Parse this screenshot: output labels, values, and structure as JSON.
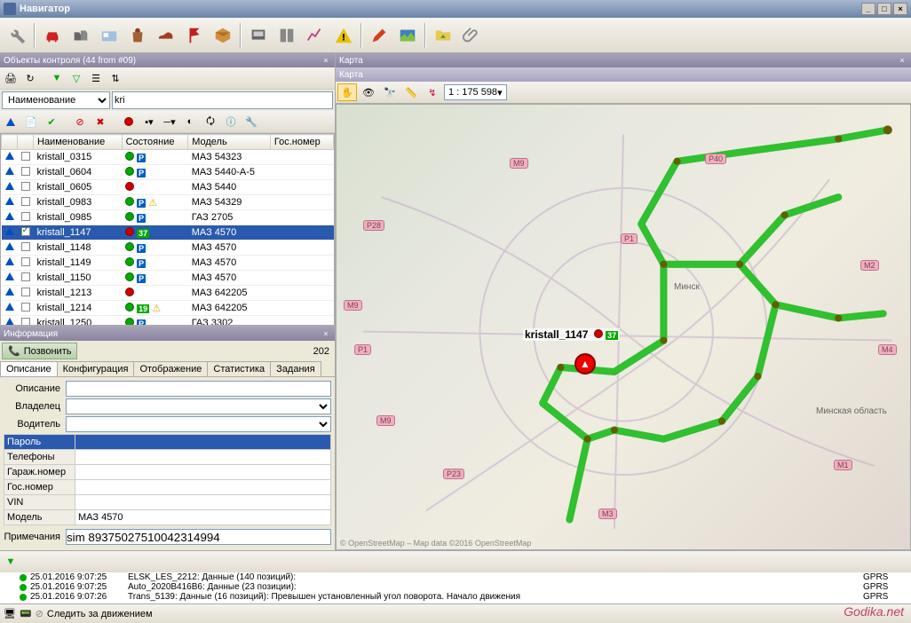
{
  "window": {
    "title": "Навигатор"
  },
  "panels": {
    "objects_title": "Объекты контроля (44 from #09)",
    "info_title": "Информация",
    "map_title": "Карта",
    "map_inner_title": "Карта"
  },
  "filter": {
    "field_label": "Наименование",
    "value": "kri"
  },
  "columns": {
    "name": "Наименование",
    "status": "Состояние",
    "model": "Модель",
    "gosnumber": "Гос.номер"
  },
  "vehicles": [
    {
      "name": "kristall_0315",
      "dot": "green",
      "badge": "P",
      "warn": false,
      "model": "МАЗ 54323",
      "selected": false,
      "checked": false
    },
    {
      "name": "kristall_0604",
      "dot": "green",
      "badge": "P",
      "warn": false,
      "model": "МАЗ 5440-А-5",
      "selected": false,
      "checked": false
    },
    {
      "name": "kristall_0605",
      "dot": "red",
      "badge": "",
      "warn": false,
      "model": "МАЗ 5440",
      "selected": false,
      "checked": false
    },
    {
      "name": "kristall_0983",
      "dot": "green",
      "badge": "P",
      "warn": true,
      "model": "МАЗ 54329",
      "selected": false,
      "checked": false
    },
    {
      "name": "kristall_0985",
      "dot": "green",
      "badge": "P",
      "warn": false,
      "model": "ГАЗ 2705",
      "selected": false,
      "checked": false
    },
    {
      "name": "kristall_1147",
      "dot": "red",
      "badge": "37",
      "warn": false,
      "model": "МАЗ 4570",
      "selected": true,
      "checked": true
    },
    {
      "name": "kristall_1148",
      "dot": "green",
      "badge": "P",
      "warn": false,
      "model": "МАЗ 4570",
      "selected": false,
      "checked": false
    },
    {
      "name": "kristall_1149",
      "dot": "green",
      "badge": "P",
      "warn": false,
      "model": "МАЗ 4570",
      "selected": false,
      "checked": false
    },
    {
      "name": "kristall_1150",
      "dot": "green",
      "badge": "P",
      "warn": false,
      "model": "МАЗ 4570",
      "selected": false,
      "checked": false
    },
    {
      "name": "kristall_1213",
      "dot": "red",
      "badge": "",
      "warn": false,
      "model": "МАЗ 642205",
      "selected": false,
      "checked": false
    },
    {
      "name": "kristall_1214",
      "dot": "green",
      "badge": "19",
      "warn": true,
      "model": "МАЗ 642205",
      "selected": false,
      "checked": false
    },
    {
      "name": "kristall_1250",
      "dot": "green",
      "badge": "P",
      "warn": false,
      "model": "ГАЗ 3302",
      "selected": false,
      "checked": false
    }
  ],
  "info": {
    "call_button": "Позвонить",
    "call_count": "202",
    "tabs": {
      "desc": "Описание",
      "config": "Конфигурация",
      "display": "Отображение",
      "stats": "Статистика",
      "tasks": "Задания"
    },
    "labels": {
      "desc": "Описание",
      "owner": "Владелец",
      "driver": "Водитель"
    },
    "props": {
      "password": "Пароль",
      "phones": "Телефоны",
      "garage": "Гараж.номер",
      "gosnumber": "Гос.номер",
      "vin": "VIN",
      "model": "Модель",
      "notes": "Примечания"
    },
    "values": {
      "password": "",
      "phones": "",
      "garage": "",
      "gosnumber": "",
      "vin": "",
      "model": "МАЗ 4570",
      "notes": "sim 89375027510042314994"
    }
  },
  "map": {
    "scale": "1 : 175 598",
    "selected_vehicle": "kristall_1147",
    "selected_badge": "37",
    "attribution": "© OpenStreetMap – Map data ©2016 OpenStreetMap",
    "city": "Минск",
    "region": "Минская область",
    "roads": [
      "P1",
      "P28",
      "M9",
      "P23",
      "M4",
      "P40",
      "M3",
      "M1",
      "M2"
    ]
  },
  "log": [
    {
      "time": "25.01.2016 9:07:25",
      "msg": "ELSK_LES_2212: Данные (140 позиций):",
      "src": "GPRS"
    },
    {
      "time": "25.01.2016 9:07:25",
      "msg": "Auto_2020B416B6: Данные (23 позиции):",
      "src": "GPRS"
    },
    {
      "time": "25.01.2016 9:07:26",
      "msg": "Trans_5139: Данные (16 позиций): Превышен установленный угол поворота. Начало движения",
      "src": "GPRS"
    }
  ],
  "status": {
    "text": "Следить за движением"
  },
  "watermark": "Godika.net"
}
